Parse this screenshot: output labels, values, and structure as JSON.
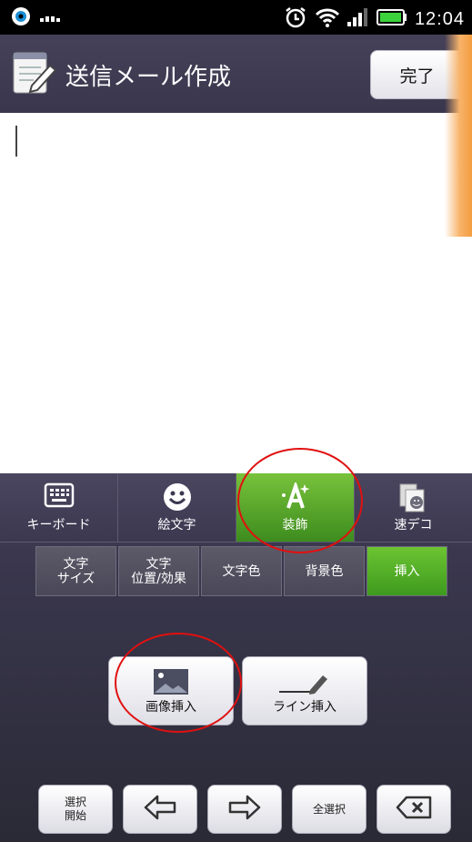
{
  "status_bar": {
    "time": "12:04"
  },
  "header": {
    "title": "送信メール作成",
    "done_label": "完了"
  },
  "tabs": [
    {
      "label": "キーボード",
      "icon": "keyboard-icon",
      "active": false
    },
    {
      "label": "絵文字",
      "icon": "smiley-icon",
      "active": false
    },
    {
      "label": "装飾",
      "icon": "decoration-a-icon",
      "active": true
    },
    {
      "label": "速デコ",
      "icon": "quick-deco-icon",
      "active": false
    }
  ],
  "subtabs": [
    {
      "label": "文字\nサイズ"
    },
    {
      "label": "文字\n位置/効果"
    },
    {
      "label": "文字色"
    },
    {
      "label": "背景色"
    },
    {
      "label": "挿入",
      "active": true
    }
  ],
  "insert_buttons": {
    "image_insert": "画像挿入",
    "line_insert": "ライン挿入"
  },
  "bottom_keys": {
    "select_start": "選択\n開始",
    "select_all": "全選択"
  },
  "colors": {
    "active_green": "#5aaa2c",
    "annotation_red": "#e01010"
  }
}
